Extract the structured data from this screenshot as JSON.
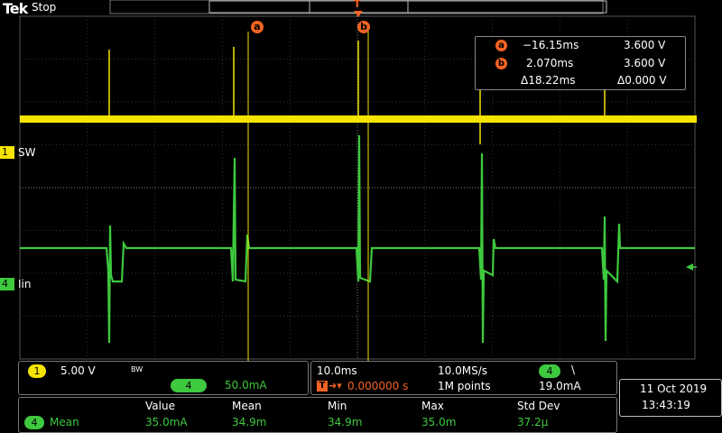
{
  "header": {
    "brand": "Tek",
    "run_state": "Stop"
  },
  "cursors": {
    "a": {
      "label": "a",
      "time": "−16.15ms",
      "value": "3.600 V"
    },
    "b": {
      "label": "b",
      "time": "2.070ms",
      "value": "3.600 V"
    },
    "delta": {
      "time": "Δ18.22ms",
      "value": "Δ0.000 V"
    }
  },
  "channels": {
    "ch1": {
      "number": "1",
      "name": "SW",
      "color": "#f5e400",
      "scale": "5.00 V",
      "bw": "BW"
    },
    "ch4": {
      "number": "4",
      "name": "Iin",
      "color": "#3ec93e",
      "scale": "50.0mA"
    }
  },
  "horizontal": {
    "time_per_div": "10.0ms",
    "sample_rate": "10.0MS/s",
    "trigger_pos": "0.000000 s",
    "record_length": "1M points",
    "trigger_source": "4",
    "trigger_slope": "\\",
    "trigger_level": "19.0mA"
  },
  "datetime": {
    "date": "11 Oct  2019",
    "time": "13:43:19"
  },
  "measurement": {
    "headers": [
      "Value",
      "Mean",
      "Min",
      "Max",
      "Std Dev"
    ],
    "channel": "4",
    "name": "Mean",
    "values": [
      "35.0mA",
      "34.9m",
      "34.9m",
      "35.0m",
      "37.2µ"
    ]
  }
}
